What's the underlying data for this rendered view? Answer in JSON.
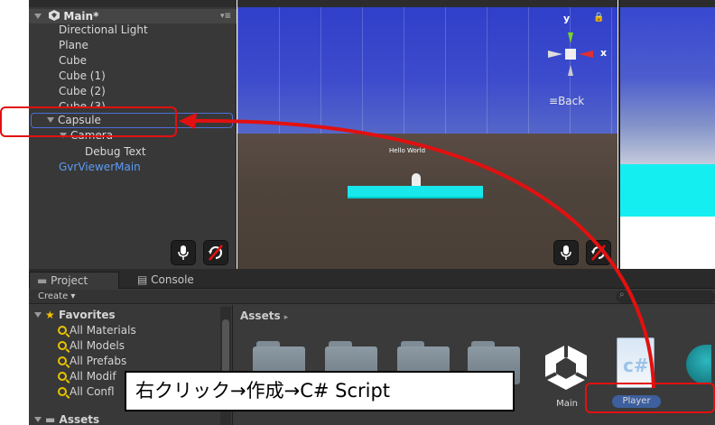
{
  "hierarchy": {
    "scene_name": "Main*",
    "items": [
      {
        "label": "Directional Light",
        "color": "normal"
      },
      {
        "label": "Plane",
        "color": "normal"
      },
      {
        "label": "Cube",
        "color": "normal"
      },
      {
        "label": "Cube (1)",
        "color": "normal"
      },
      {
        "label": "Cube (2)",
        "color": "normal"
      },
      {
        "label": "Cube (3)",
        "color": "normal"
      },
      {
        "label": "Capsule",
        "color": "normal"
      },
      {
        "label": "Camera",
        "color": "normal"
      },
      {
        "label": "Debug Text",
        "color": "normal"
      },
      {
        "label": "GvrViewerMain",
        "color": "blue"
      }
    ]
  },
  "scene_view": {
    "gizmo": {
      "y_label": "y",
      "x_label": "x",
      "view_name": "Back"
    },
    "world_text": "Hello World"
  },
  "project": {
    "tabs": [
      {
        "label": "Project"
      },
      {
        "label": "Console"
      }
    ],
    "create_label": "Create",
    "favorites": {
      "header": "Favorites",
      "items": [
        "All Materials",
        "All Models",
        "All Prefabs",
        "All Modif",
        "All Confl"
      ]
    },
    "assets_header": "Assets",
    "breadcrumb": "Assets",
    "asset_items": [
      "Main",
      "Player"
    ]
  },
  "annotation": {
    "text": "右クリック→作成→C# Script"
  },
  "colors": {
    "highlight_red": "#e21010",
    "selection_blue": "#4d6fd8",
    "cyan_plane": "#18e8ec"
  }
}
